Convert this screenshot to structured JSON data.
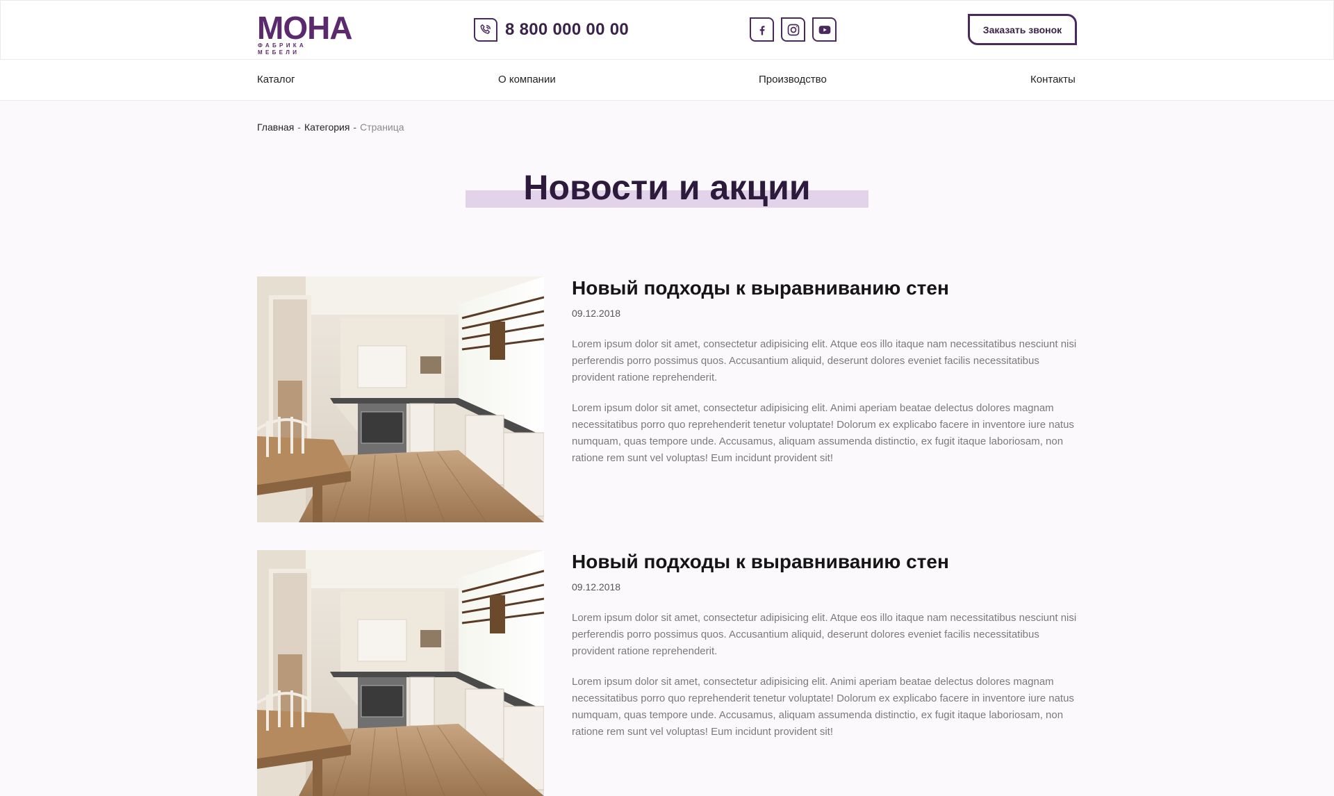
{
  "header": {
    "logo_word": "МОНА",
    "logo_sub": "ФАБРИКА МЕБЕЛИ",
    "phone": "8 800 000 00 00",
    "socials": [
      "facebook-icon",
      "instagram-icon",
      "youtube-icon"
    ],
    "callback_label": "Заказать звонок",
    "accent": "#4a2a5c"
  },
  "nav": {
    "items": [
      "Каталог",
      "О компании",
      "Производство",
      "Контакты"
    ]
  },
  "breadcrumb": {
    "home": "Главная",
    "category": "Категория",
    "current": "Страница"
  },
  "page": {
    "title": "Новости и акции",
    "title_highlight": "#e2d3ea"
  },
  "news": [
    {
      "title": "Новый подходы к выравниванию стен",
      "date": "09.12.2018",
      "paragraphs": [
        "Lorem ipsum dolor sit amet, consectetur adipisicing elit. Atque eos illo itaque nam necessitatibus nesciunt nisi perferendis porro possimus quos. Accusantium aliquid, deserunt dolores eveniet facilis necessitatibus provident ratione reprehenderit.",
        "Lorem ipsum dolor sit amet, consectetur adipisicing elit. Animi aperiam beatae delectus dolores magnam necessitatibus porro quo reprehenderit tenetur voluptate! Dolorum ex explicabo facere in inventore iure natus numquam, quas tempore unde. Accusamus, aliquam assumenda distinctio, ex fugit itaque laboriosam, non ratione rem sunt vel voluptas! Eum incidunt provident sit!"
      ]
    },
    {
      "title": "Новый подходы к выравниванию стен",
      "date": "09.12.2018",
      "paragraphs": [
        "Lorem ipsum dolor sit amet, consectetur adipisicing elit. Atque eos illo itaque nam necessitatibus nesciunt nisi perferendis porro possimus quos. Accusantium aliquid, deserunt dolores eveniet facilis necessitatibus provident ratione reprehenderit.",
        "Lorem ipsum dolor sit amet, consectetur adipisicing elit. Animi aperiam beatae delectus dolores magnam necessitatibus porro quo reprehenderit tenetur voluptate! Dolorum ex explicabo facere in inventore iure natus numquam, quas tempore unde. Accusamus, aliquam assumenda distinctio, ex fugit itaque laboriosam, non ratione rem sunt vel voluptas! Eum incidunt provident sit!"
      ]
    }
  ]
}
